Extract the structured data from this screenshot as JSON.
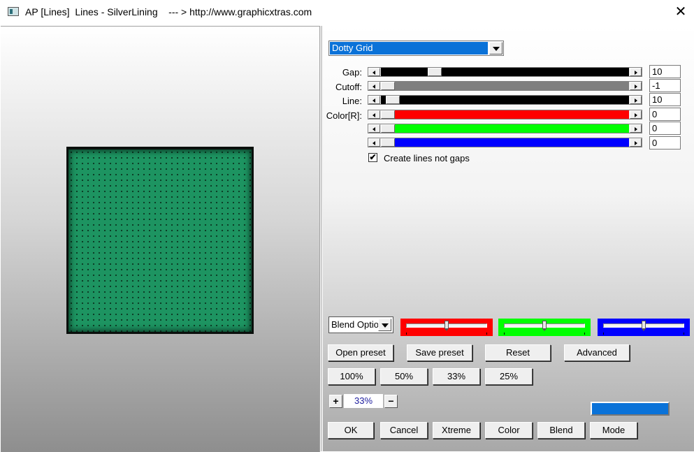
{
  "window": {
    "title": "AP [Lines]  Lines - SilverLining    --- > http://www.graphicxtras.com",
    "close_glyph": "✕"
  },
  "preset": {
    "selected": "Dotty Grid"
  },
  "params": [
    {
      "label": "Gap:",
      "value": "10",
      "fill_color": "#000000",
      "fraction": 0.2
    },
    {
      "label": "Cutoff:",
      "value": "-1",
      "fill_color": "#7f7f7f",
      "fraction": 0.0
    },
    {
      "label": "Line:",
      "value": "10",
      "fill_color": "#000000",
      "fraction": 0.02
    },
    {
      "label": "Color[R]:",
      "value": "0",
      "fill_color": "#ff0000",
      "fraction": 0.0
    },
    {
      "label": "",
      "value": "0",
      "fill_color": "#00ff00",
      "fraction": 0.0
    },
    {
      "label": "",
      "value": "0",
      "fill_color": "#0000ff",
      "fraction": 0.0
    }
  ],
  "create_lines": {
    "label": "Create lines not gaps",
    "checked": true,
    "check_glyph": "✔"
  },
  "blend": {
    "selected": "Blend Options",
    "channel_sliders": [
      {
        "color": "#ff0000",
        "level": 0.5
      },
      {
        "color": "#00ff00",
        "level": 0.5
      },
      {
        "color": "#0000ff",
        "level": 0.5
      }
    ]
  },
  "buttons": {
    "open_preset": "Open preset",
    "save_preset": "Save preset",
    "reset": "Reset",
    "advanced": "Advanced",
    "zoom_100": "100%",
    "zoom_50": "50%",
    "zoom_33": "33%",
    "zoom_25": "25%",
    "ok": "OK",
    "cancel": "Cancel",
    "xtreme": "Xtreme",
    "color": "Color",
    "blend": "Blend",
    "mode": "Mode"
  },
  "zoom": {
    "plus": "+",
    "minus": "−",
    "value": "33%"
  },
  "swatch": {
    "color": "#0a72d8"
  },
  "preview": {
    "fill_color": "#1d9461",
    "dot_color": "#0c3a24"
  }
}
